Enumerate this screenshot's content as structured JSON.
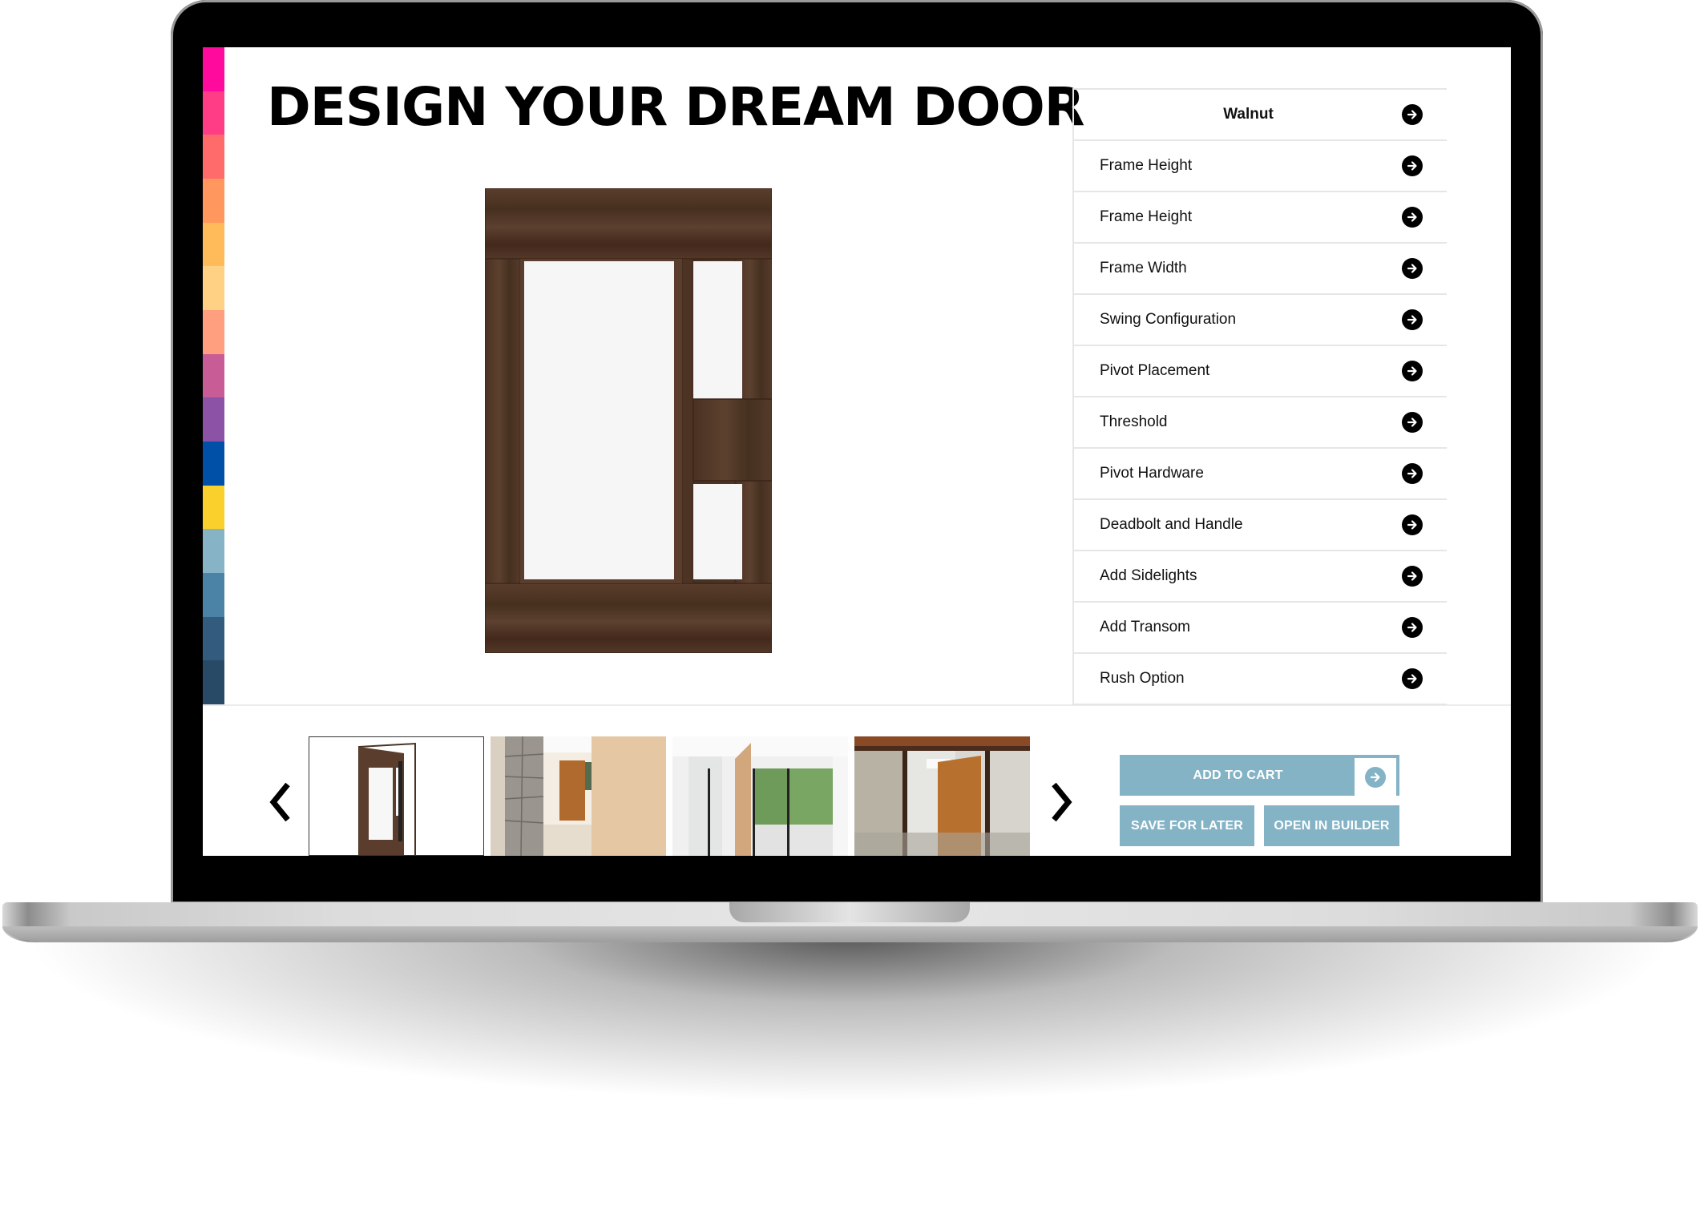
{
  "page": {
    "title": "DESIGN YOUR DREAM DOOR"
  },
  "brand_strip": {
    "colors": [
      "#ff0a9c",
      "#ff3d86",
      "#ff6a6a",
      "#ff975e",
      "#ffbb5a",
      "#ffd185",
      "#ff9f7f",
      "#c85c96",
      "#8b52a6",
      "#0050a8",
      "#fad12c",
      "#86b4c6",
      "#4b83a6",
      "#335b7e",
      "#284a66"
    ]
  },
  "options_panel": {
    "header": "Walnut",
    "items": [
      {
        "label": "Frame Height"
      },
      {
        "label": "Frame Height"
      },
      {
        "label": "Frame Width"
      },
      {
        "label": "Swing Configuration"
      },
      {
        "label": "Pivot Placement"
      },
      {
        "label": "Threshold"
      },
      {
        "label": "Pivot Hardware"
      },
      {
        "label": "Deadbolt and Handle"
      },
      {
        "label": "Add Sidelights"
      },
      {
        "label": "Add Transom"
      },
      {
        "label": "Rush Option"
      }
    ],
    "icon": "arrow-right-circle-icon"
  },
  "preview": {
    "finish": "Walnut",
    "wood_color": "#4e3426"
  },
  "gallery": {
    "prev_icon": "chevron-left-icon",
    "next_icon": "chevron-right-icon",
    "thumbnails": [
      {
        "name": "walnut-pivot-door-open",
        "active": true
      },
      {
        "name": "stone-hallway-wood-door",
        "active": false
      },
      {
        "name": "pivot-door-garden-view",
        "active": false
      },
      {
        "name": "pivot-door-glass-walls",
        "active": false
      }
    ]
  },
  "actions": {
    "add_to_cart": "ADD TO CART",
    "save_for_later": "SAVE FOR LATER",
    "open_in_builder": "OPEN IN BUILDER",
    "accent_color": "#84b3c6"
  }
}
